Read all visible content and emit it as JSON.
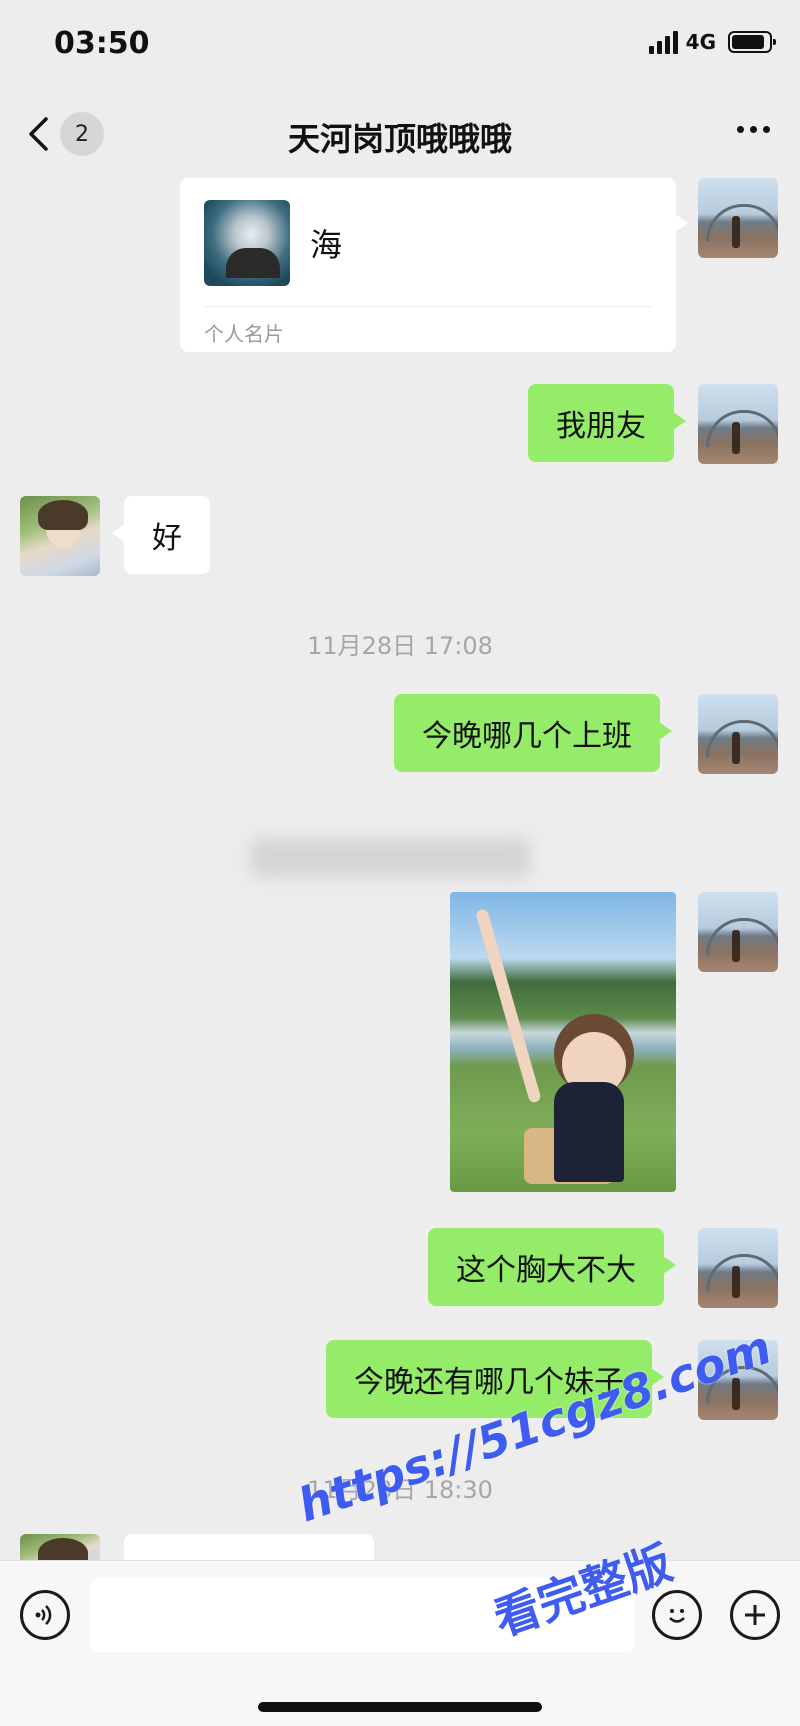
{
  "status_bar": {
    "time": "03:50",
    "network": "4G"
  },
  "nav": {
    "back_count": "2",
    "title": "天河岗顶哦哦哦"
  },
  "messages": [
    {
      "type": "card",
      "side": "right",
      "name": "海",
      "card_label": "个人名片"
    },
    {
      "type": "text",
      "side": "right",
      "text": "我朋友"
    },
    {
      "type": "text",
      "side": "left",
      "text": "好"
    },
    {
      "type": "timestamp",
      "text": "11月28日 17:08"
    },
    {
      "type": "text",
      "side": "right",
      "text": "今晚哪几个上班"
    },
    {
      "type": "image",
      "side": "right"
    },
    {
      "type": "text",
      "side": "right",
      "text": "这个胸大不大"
    },
    {
      "type": "text",
      "side": "right",
      "text": "今晚还有哪几个妹子"
    },
    {
      "type": "timestamp",
      "text": "11月28日 18:30"
    }
  ],
  "input_bar": {
    "voice_icon": "voice-icon",
    "emoji_icon": "emoji-icon",
    "plus_icon": "plus-icon"
  },
  "watermark": {
    "url": "https://51cgz8.com",
    "text": "看完整版"
  },
  "colors": {
    "sent_bubble": "#95ec69",
    "received_bubble": "#ffffff",
    "background": "#ededed",
    "watermark": "#3f5cf0"
  }
}
